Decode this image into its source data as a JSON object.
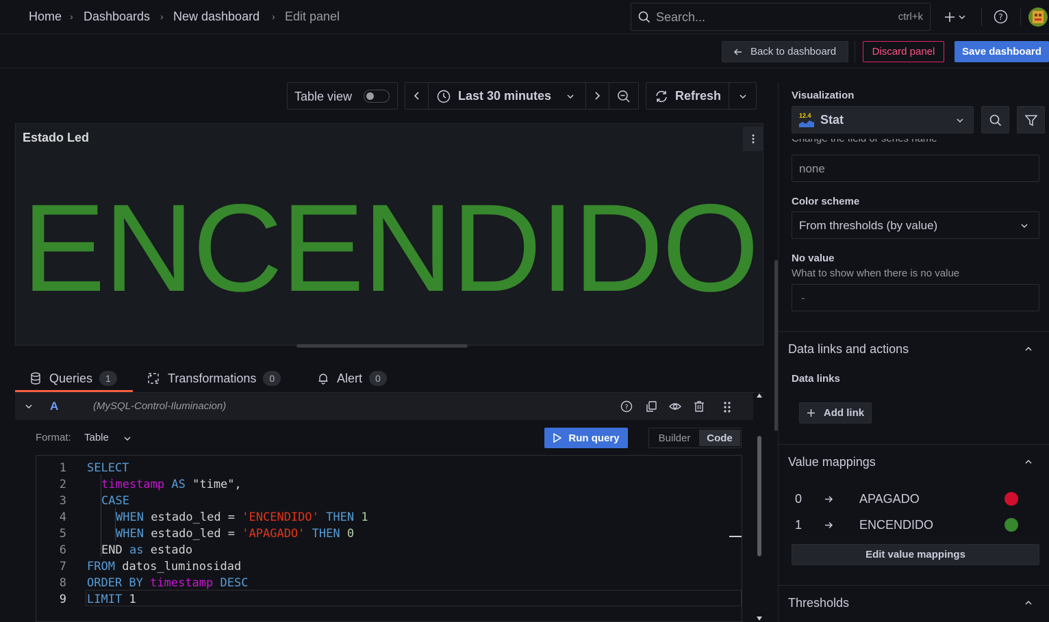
{
  "breadcrumb": [
    "Home",
    "Dashboards",
    "New dashboard",
    "Edit panel"
  ],
  "search": {
    "placeholder": "Search...",
    "shortcut": "ctrl+k"
  },
  "toolbar": {
    "back_label": "Back to dashboard",
    "discard_label": "Discard panel",
    "save_label": "Save dashboard",
    "table_view_label": "Table view",
    "time_range": "Last 30 minutes",
    "refresh_label": "Refresh"
  },
  "panel": {
    "title": "Estado Led",
    "stat_value": "ENCENDIDO",
    "stat_color": "#37872d"
  },
  "tabs": [
    {
      "label": "Queries",
      "count": "1"
    },
    {
      "label": "Transformations",
      "count": "0"
    },
    {
      "label": "Alert",
      "count": "0"
    }
  ],
  "query": {
    "ref_id": "A",
    "datasource": "(MySQL-Control-Iluminacion)",
    "format_label": "Format:",
    "format_value": "Table",
    "run_label": "Run query",
    "builder_label": "Builder",
    "code_label": "Code",
    "line_numbers": [
      "1",
      "2",
      "3",
      "4",
      "5",
      "6",
      "7",
      "8",
      "9"
    ],
    "code": {
      "l1": "SELECT",
      "l2a": "timestamp",
      "l2b": "AS",
      "l2c": "\"time\",",
      "l3": "CASE",
      "l4a": "WHEN",
      "l4b": "estado_led =",
      "l4c": "'ENCENDIDO'",
      "l4d": "THEN",
      "l4e": "1",
      "l5a": "WHEN",
      "l5b": "estado_led =",
      "l5c": "'APAGADO'",
      "l5d": "THEN",
      "l5e": "0",
      "l6a": "END",
      "l6b": "as",
      "l6c": "estado",
      "l7a": "FROM",
      "l7b": "datos_luminosidad",
      "l8a": "ORDER BY",
      "l8b": "timestamp",
      "l8c": "DESC",
      "l9a": "LIMIT",
      "l9b": "1"
    }
  },
  "options": {
    "visualization_label": "Visualization",
    "visualization_value": "Stat",
    "visualization_icon_text": "12.4",
    "field_hint": "Change the field or series name",
    "field_value": "none",
    "color_scheme_label": "Color scheme",
    "color_scheme_value": "From thresholds (by value)",
    "no_value_label": "No value",
    "no_value_desc": "What to show when there is no value",
    "no_value_placeholder": "-",
    "data_links_section": "Data links and actions",
    "data_links_label": "Data links",
    "add_link_label": "Add link",
    "value_mappings_section": "Value mappings",
    "mappings": [
      {
        "from": "0",
        "to": "APAGADO",
        "color": "#d10e2e"
      },
      {
        "from": "1",
        "to": "ENCENDIDO",
        "color": "#37872d"
      }
    ],
    "edit_mappings_label": "Edit value mappings",
    "thresholds_section": "Thresholds"
  }
}
